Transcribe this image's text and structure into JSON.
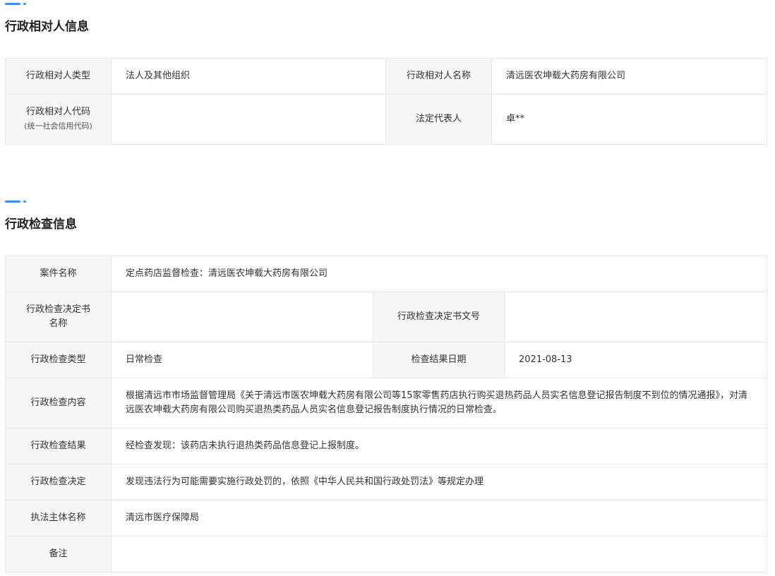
{
  "section1": {
    "title": "行政相对人信息",
    "rows": {
      "type_label": "行政相对人类型",
      "type_value": "法人及其他组织",
      "name_label": "行政相对人名称",
      "name_value": "清远医农坤载大药房有限公司",
      "code_label": "行政相对人代码",
      "code_sublabel": "(统一社会信用代码)",
      "code_value": "",
      "rep_label": "法定代表人",
      "rep_value": "卓**"
    }
  },
  "section2": {
    "title": "行政检查信息",
    "rows": {
      "case_label": "案件名称",
      "case_value": "定点药店监督检查：清远医农坤载大药房有限公司",
      "doc_name_label_1": "行政检查决定书",
      "doc_name_label_2": "名称",
      "doc_name_value": "",
      "doc_no_label": "行政检查决定书文号",
      "doc_no_value": "",
      "check_type_label": "行政检查类型",
      "check_type_value": "日常检查",
      "result_date_label": "检查结果日期",
      "result_date_value": "2021-08-13",
      "content_label": "行政检查内容",
      "content_value": "根据清远市市场监督管理局《关于清远市医农坤载大药房有限公司等15家零售药店执行购买退热药品人员实名信息登记报告制度不到位的情况通报》，对清远医农坤载大药房有限公司购买退热类药品人员实名信息登记报告制度执行情况的日常检查。",
      "result_label": "行政检查结果",
      "result_value": "经检查发现：该药店未执行退热类药品信息登记上报制度。",
      "decision_label": "行政检查决定",
      "decision_value": "发现违法行为可能需要实施行政处罚的，依照《中华人民共和国行政处罚法》等规定办理",
      "agency_label": "执法主体名称",
      "agency_value": "清远市医疗保障局",
      "remark_label": "备注",
      "remark_value": ""
    }
  }
}
